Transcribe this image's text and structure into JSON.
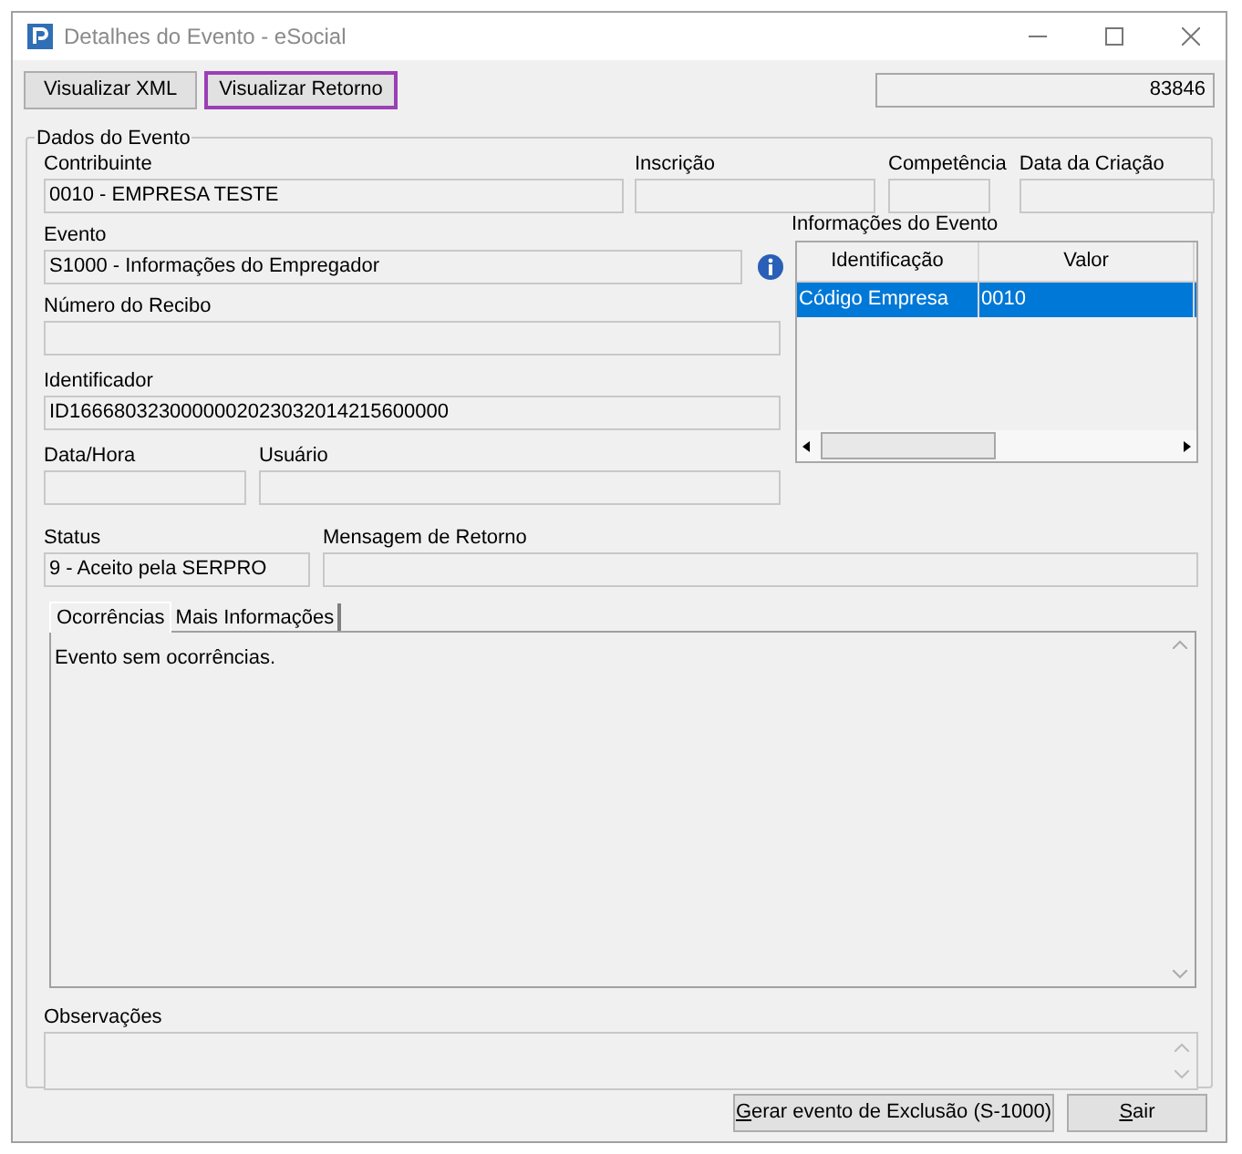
{
  "window": {
    "title": "Detalhes do Evento - eSocial"
  },
  "toolbar": {
    "buttons": [
      {
        "label": "Visualizar XML",
        "selected": false
      },
      {
        "label": "Visualizar Retorno",
        "selected": true
      }
    ],
    "record_id": "83846"
  },
  "group": {
    "title": "Dados do Evento"
  },
  "fields": [
    {
      "label": "Contribuinte",
      "value": "0010 - EMPRESA TESTE"
    },
    {
      "label": "Inscrição"
    },
    {
      "label": "Competência"
    },
    {
      "label": "Data da Criação"
    },
    {
      "label": "Evento",
      "value": "S1000 - Informações do Empregador"
    },
    {
      "label": "Número do Recibo"
    },
    {
      "label": "Identificador",
      "value": "ID1666803230000002023032014215600000"
    },
    {
      "label": "Data/Hora"
    },
    {
      "label": "Usuário"
    },
    {
      "label": "Status",
      "value": "9 - Aceito pela SERPRO"
    },
    {
      "label": "Mensagem de Retorno"
    }
  ],
  "event_info": {
    "title": "Informações do Evento",
    "columns": [
      "Identificação",
      "Valor"
    ],
    "rows": [
      {
        "cells": [
          "Código Empresa",
          "0010"
        ],
        "selected": true
      }
    ]
  },
  "tabs": [
    {
      "label": "Ocorrências",
      "selected": true
    },
    {
      "label": "Mais Informações",
      "selected": false
    }
  ],
  "occurrences_text": "Evento sem ocorrências.",
  "observations": {
    "label": "Observações"
  },
  "footer_buttons": [
    "Gerar evento de Exclusão (S-1000)",
    "Sair"
  ]
}
